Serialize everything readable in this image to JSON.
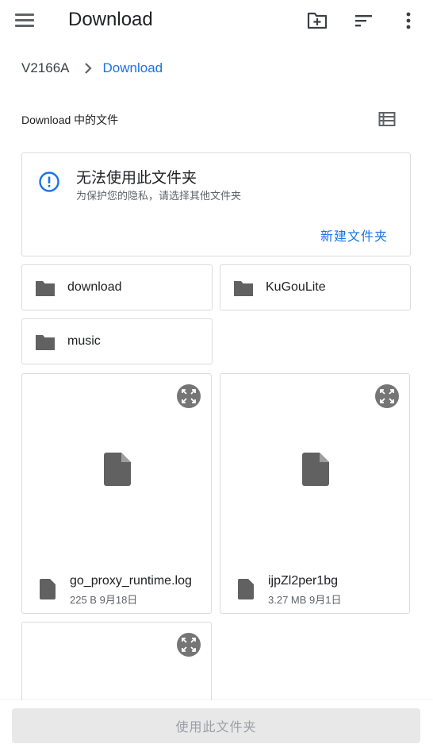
{
  "appbar": {
    "title": "Download",
    "icons": [
      "menu-icon",
      "new-folder-icon",
      "sort-icon",
      "more-vert-icon"
    ]
  },
  "breadcrumb": {
    "root": "V2166A",
    "current": "Download"
  },
  "section": {
    "label": "Download 中的文件"
  },
  "warning": {
    "title": "无法使用此文件夹",
    "subtitle": "为保护您的隐私，请选择其他文件夹",
    "action": "新建文件夹"
  },
  "folders": [
    {
      "name": "download"
    },
    {
      "name": "KuGouLite"
    },
    {
      "name": "music"
    }
  ],
  "files": [
    {
      "name": "go_proxy_runtime.log",
      "size": "225 B",
      "date": "9月18日"
    },
    {
      "name": "ijpZl2per1bg",
      "size": "3.27 MB",
      "date": "9月1日"
    }
  ],
  "bottom": {
    "button_label": "使用此文件夹"
  },
  "colors": {
    "accent": "#1a73e8",
    "icon_grey": "#616161",
    "border": "#dadce0"
  }
}
